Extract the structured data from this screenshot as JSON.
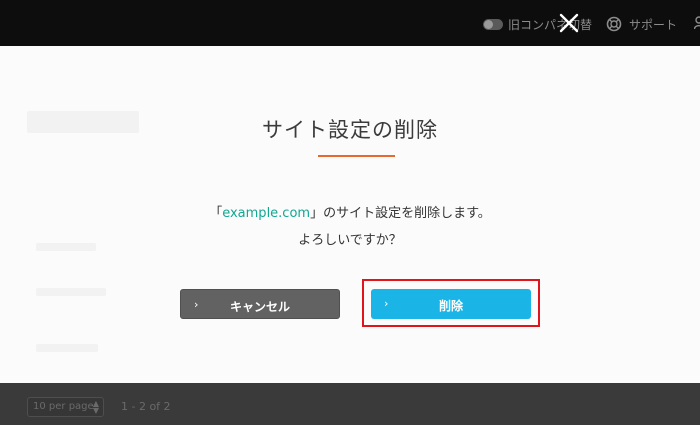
{
  "header": {
    "toggle_label": "旧コンパネ切替",
    "support_label": "サポート"
  },
  "modal": {
    "title": "サイト設定の削除",
    "message_open_bracket": "「",
    "domain": "example.com",
    "message_rest": "」のサイト設定を削除します。",
    "message_line2": "よろしいですか？",
    "cancel_label": "キャンセル",
    "delete_label": "削除",
    "chevron": "›"
  },
  "footer": {
    "per_page": "10 per page",
    "range": "1 - 2 of 2"
  },
  "colors": {
    "accent_underline": "#e8692d",
    "domain_text": "#11a892",
    "delete_button": "#1ab5e6",
    "cancel_button": "#626262",
    "highlight_box": "#e1141c"
  },
  "icons": [
    "close-icon",
    "toggle-switch",
    "support-lifebuoy-icon",
    "user-icon",
    "chevron-right-icon",
    "select-arrows-icon"
  ]
}
